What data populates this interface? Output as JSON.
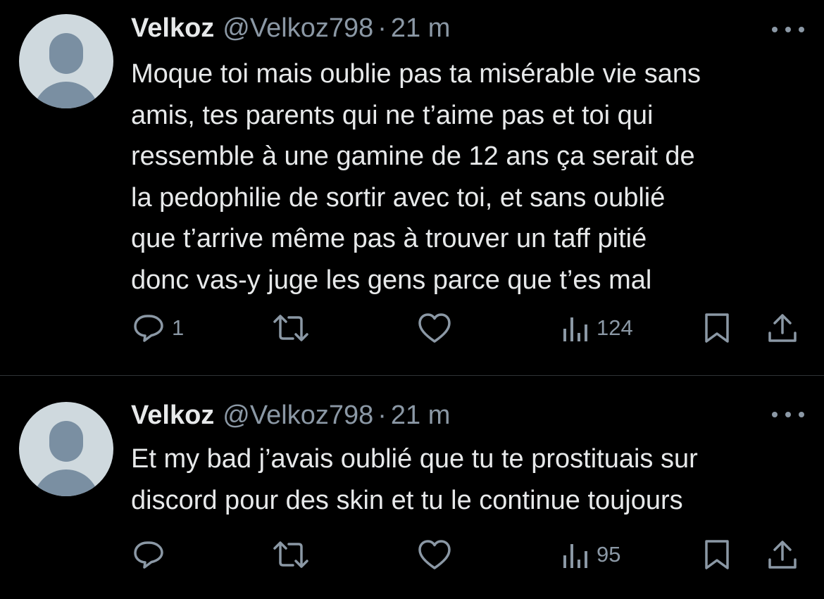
{
  "tweets": [
    {
      "author_name": "Velkoz",
      "author_handle": "@Velkoz798",
      "separator": "·",
      "time": "21 m",
      "text": "Moque toi mais oublie pas ta misérable vie sans\namis, tes parents qui ne t’aime pas et toi qui\nressemble à une gamine de 12 ans ça serait de\nla pedophilie de sortir avec toi, et sans oublié\nque t’arrive même pas à trouver un taff pitié\ndonc vas-y juge les gens parce que t’es mal",
      "reply_count": "1",
      "view_count": "124"
    },
    {
      "author_name": "Velkoz",
      "author_handle": "@Velkoz798",
      "separator": "·",
      "time": "21 m",
      "text": "Et my bad j’avais oublié que tu te prostituais sur\ndiscord pour des skin et tu le continue toujours",
      "reply_count": "",
      "view_count": "95"
    }
  ],
  "icons": {
    "reply": "reply-icon",
    "retweet": "retweet-icon",
    "like": "heart-icon",
    "views": "views-icon",
    "bookmark": "bookmark-icon",
    "share": "share-icon",
    "more": "more-icon"
  },
  "colors": {
    "background": "#000000",
    "text_primary": "#e7e9ea",
    "text_secondary": "#8b98a5",
    "divider": "#2f3336",
    "avatar_bg": "#cfd9de",
    "avatar_fg": "#7a8fa2"
  }
}
